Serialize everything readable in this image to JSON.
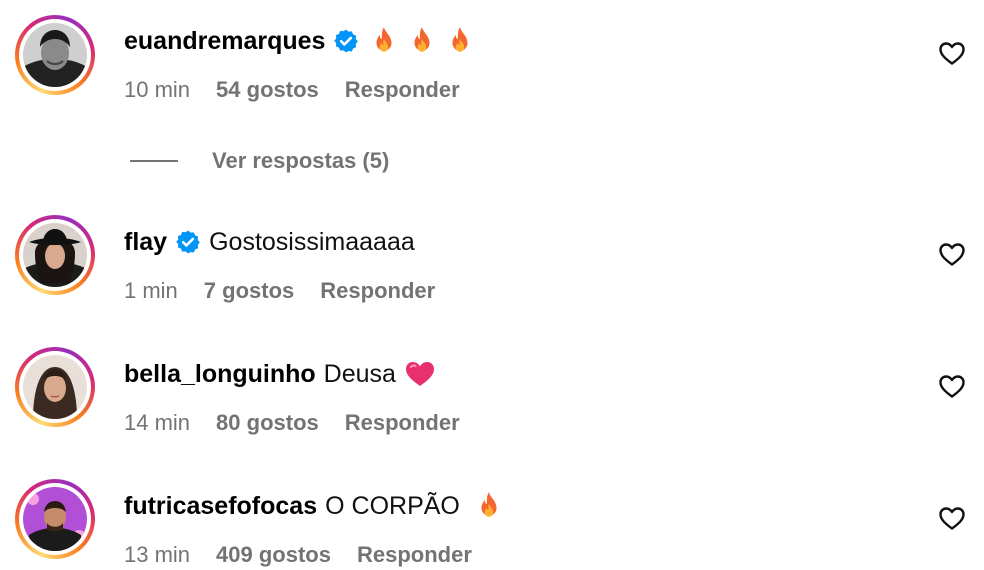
{
  "comments": [
    {
      "username": "euandremarques",
      "verified": true,
      "text": "",
      "emoji": [
        "fire-icon",
        "fire-icon",
        "fire-icon"
      ],
      "time": "10 min",
      "likes": "54 gostos",
      "reply_label": "Responder",
      "view_replies": "Ver respostas (5)"
    },
    {
      "username": "flay",
      "verified": true,
      "text": "Gostosissimaaaaa",
      "emoji": [],
      "time": "1 min",
      "likes": "7 gostos",
      "reply_label": "Responder"
    },
    {
      "username": "bella_longuinho",
      "verified": false,
      "text": "Deusa",
      "emoji": [
        "pink-heart-icon"
      ],
      "time": "14 min",
      "likes": "80 gostos",
      "reply_label": "Responder"
    },
    {
      "username": "futricasefofocas",
      "verified": false,
      "text": "O CORPÃO",
      "emoji": [
        "fire-icon"
      ],
      "time": "13 min",
      "likes": "409 gostos",
      "reply_label": "Responder"
    }
  ],
  "colors": {
    "verified_blue": "#0095f6",
    "secondary_text": "#737373",
    "heart_pink": "#e8306e"
  }
}
